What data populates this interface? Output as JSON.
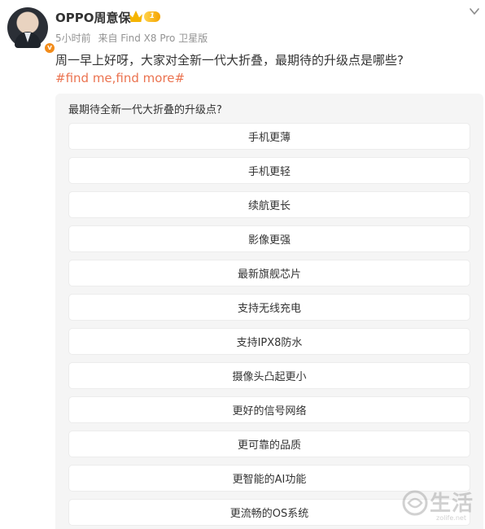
{
  "author": {
    "name": "OPPO周意保",
    "level_badge": "1",
    "verified_mark": "v"
  },
  "meta": {
    "time": "5小时前",
    "source": "来自 Find X8 Pro 卫星版"
  },
  "post": {
    "text": "周一早上好呀，大家对全新一代大折叠，最期待的升级点是哪些?",
    "hashtag": "#find me,find more#"
  },
  "poll": {
    "question": "最期待全新一代大折叠的升级点?",
    "options": [
      "手机更薄",
      "手机更轻",
      "续航更长",
      "影像更强",
      "最新旗舰芯片",
      "支持无线充电",
      "支持IPX8防水",
      "摄像头凸起更小",
      "更好的信号网络",
      "更可靠的品质",
      "更智能的AI功能",
      "更流畅的OS系统"
    ]
  },
  "watermark": {
    "text": "生活",
    "url": "zolife.net"
  },
  "colors": {
    "hashtag": "#eb7350",
    "meta": "#939393",
    "poll_bg": "#f5f5f5",
    "verified": "#f28c1b",
    "crown": "#f5b400"
  },
  "icons": [
    "chevron-down-icon",
    "crown-icon",
    "verified-icon"
  ]
}
